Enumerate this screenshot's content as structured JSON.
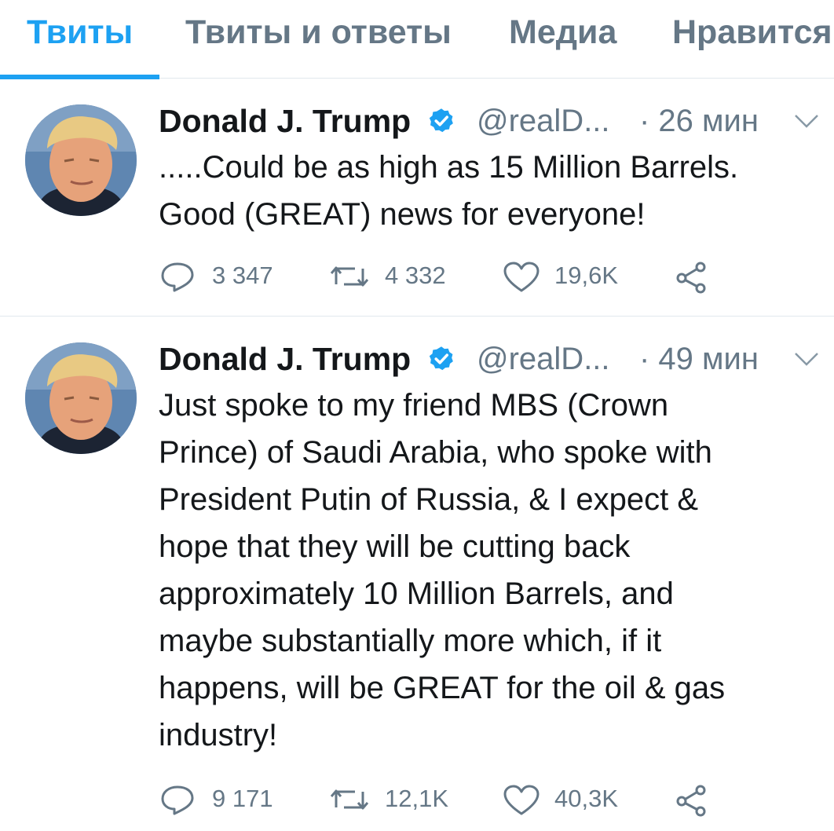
{
  "tabs": [
    {
      "label": "Твиты",
      "active": true
    },
    {
      "label": "Твиты и ответы",
      "active": false
    },
    {
      "label": "Медиа",
      "active": false
    },
    {
      "label": "Нравится",
      "active": false
    }
  ],
  "colors": {
    "accent": "#1da1f2",
    "secondary_text": "#657786",
    "primary_text": "#14171a",
    "divider": "#e1e8ed"
  },
  "tweets": [
    {
      "author_name": "Donald J. Trump",
      "handle": "@realD...",
      "time": "· 26 мин",
      "text_lines": [
        ".....Could be as high as 15 Million Barrels.",
        "Good (GREAT) news for everyone!"
      ],
      "replies": "3 347",
      "retweets": "4 332",
      "likes": "19,6K"
    },
    {
      "author_name": "Donald J. Trump",
      "handle": "@realD...",
      "time": "· 49 мин",
      "text_lines": [
        "Just spoke to my friend MBS (Crown",
        "Prince) of Saudi Arabia, who spoke with",
        "President Putin of Russia, & I expect &",
        "hope that they will be cutting back",
        "approximately 10 Million Barrels, and",
        "maybe substantially more which, if it",
        "happens, will be GREAT for the oil & gas",
        "industry!"
      ],
      "replies": "9 171",
      "retweets": "12,1K",
      "likes": "40,3K"
    }
  ],
  "icons": {
    "verified": "verified-badge-icon",
    "caret": "chevron-down-icon",
    "reply": "reply-icon",
    "retweet": "retweet-icon",
    "like": "heart-icon",
    "share": "share-icon"
  }
}
